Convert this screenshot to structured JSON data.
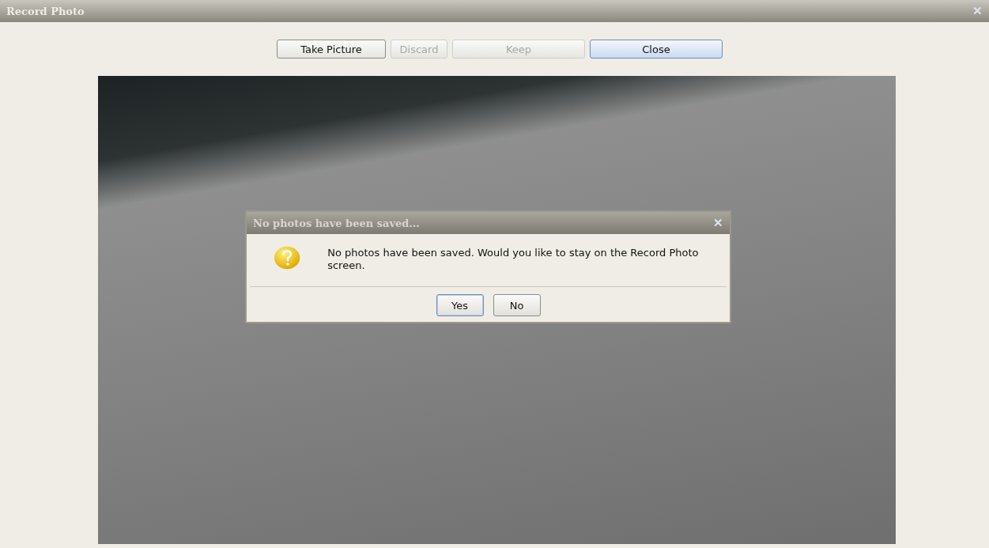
{
  "window": {
    "title": "Record Photo",
    "close": "✕"
  },
  "toolbar": [
    {
      "label": "Take Picture",
      "disabled": false,
      "default": false
    },
    {
      "label": "Discard",
      "disabled": true,
      "default": false
    },
    {
      "label": "Keep",
      "disabled": true,
      "default": false
    },
    {
      "label": "Close",
      "disabled": false,
      "default": true
    }
  ],
  "dialog": {
    "title": "No photos have been saved...",
    "close": "✕",
    "message": "No photos have been saved. Would you like to stay on the Record Photo screen.",
    "buttons": [
      {
        "label": "Yes",
        "selected": true
      },
      {
        "label": "No",
        "selected": false
      }
    ]
  }
}
